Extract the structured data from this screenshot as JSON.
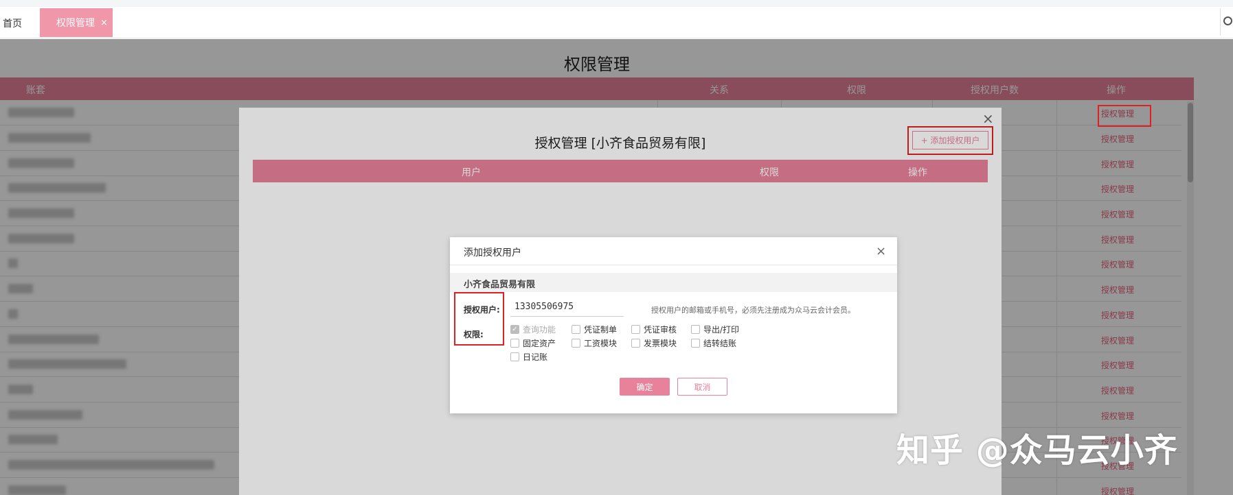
{
  "tabs": {
    "home": "首页",
    "active": "权限管理",
    "active_close": "×"
  },
  "page": {
    "title": "权限管理",
    "columns": {
      "account": "账套",
      "relation": "关系",
      "permission": "权限",
      "user_count": "授权用户数",
      "action": "操作"
    },
    "row_action": "授权管理",
    "rows": [
      "授权管理",
      "授权管理",
      "授权管理",
      "授权管理",
      "授权管理",
      "授权管理",
      "授权管理",
      "授权管理",
      "授权管理",
      "授权管理",
      "授权管理",
      "授权管理",
      "授权管理",
      "授权管理",
      "授权管理",
      "授权管理"
    ]
  },
  "auth_modal": {
    "title": "授权管理 [小齐食品贸易有限]",
    "close": "×",
    "add_button": "+ 添加授权用户",
    "columns": {
      "user": "用户",
      "permission": "权限",
      "action": "操作"
    }
  },
  "add_modal": {
    "title": "添加授权用户",
    "close": "×",
    "company": "小齐食品贸易有限",
    "user_label": "授权用户:",
    "perm_label": "权限:",
    "user_value": "13305506975",
    "hint": "授权用户的邮箱或手机号，必须先注册成为众马云会计会员。",
    "permissions": [
      {
        "label": "查询功能",
        "checked": true,
        "disabled": true
      },
      {
        "label": "凭证制单",
        "checked": false
      },
      {
        "label": "凭证审核",
        "checked": false
      },
      {
        "label": "导出/打印",
        "checked": false
      },
      {
        "label": "固定资产",
        "checked": false
      },
      {
        "label": "工资模块",
        "checked": false
      },
      {
        "label": "发票模块",
        "checked": false
      },
      {
        "label": "结转结账",
        "checked": false
      },
      {
        "label": "日记账",
        "checked": false
      }
    ],
    "ok": "确定",
    "cancel": "取消"
  },
  "watermark": "知乎 @众马云小齐",
  "colors": {
    "accent": "#e8819a",
    "tab_active": "#f097aa",
    "highlight": "#e02020"
  }
}
